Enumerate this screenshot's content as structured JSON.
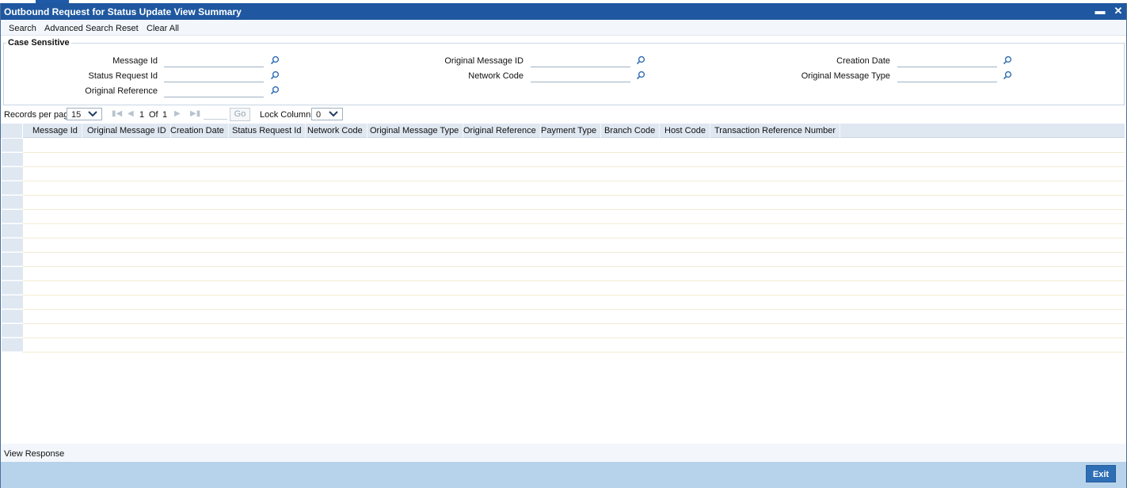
{
  "window": {
    "title": "Outbound Request for Status Update View Summary",
    "minimize_glyph": "▬",
    "close_glyph": "✕"
  },
  "toolbar": {
    "search": "Search",
    "advanced_search": "Advanced Search",
    "reset": "Reset",
    "clear_all": "Clear All"
  },
  "criteria": {
    "legend": "Case Sensitive",
    "fields": {
      "message_id": {
        "label": "Message Id",
        "value": ""
      },
      "status_request_id": {
        "label": "Status Request Id",
        "value": ""
      },
      "original_reference": {
        "label": "Original Reference",
        "value": ""
      },
      "original_message_id": {
        "label": "Original Message ID",
        "value": ""
      },
      "network_code": {
        "label": "Network Code",
        "value": ""
      },
      "creation_date": {
        "label": "Creation Date",
        "value": ""
      },
      "original_message_type": {
        "label": "Original Message Type",
        "value": ""
      }
    },
    "search_icon": "magnifier-icon"
  },
  "pager": {
    "records_per_page_label": "Records per page",
    "records_per_page": "15",
    "current_page": "1",
    "of_label": "Of",
    "total_pages": "1",
    "go_label": "Go",
    "go_value": "",
    "lock_columns_label": "Lock Columns",
    "lock_columns": "0"
  },
  "grid": {
    "columns": [
      "Message Id",
      "Original Message ID",
      "Creation Date",
      "Status Request Id",
      "Network Code",
      "Original Message Type",
      "Original Reference",
      "Payment Type",
      "Branch Code",
      "Host Code",
      "Transaction Reference Number"
    ],
    "rows": []
  },
  "footer": {
    "view_response": "View Response",
    "exit": "Exit"
  },
  "colors": {
    "title_bar": "#1f58a0",
    "bottom_bar": "#b7d3eb",
    "exit_button": "#2e6eb5",
    "grid_header": "#dfe7f1"
  }
}
